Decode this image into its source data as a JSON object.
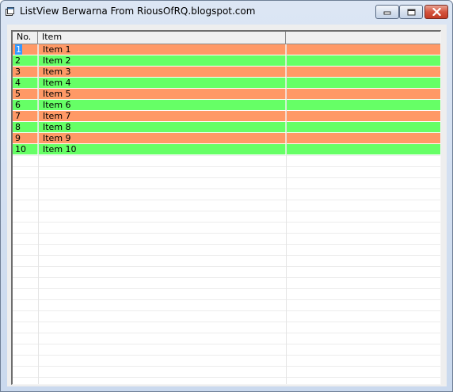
{
  "window": {
    "title": "ListView Berwarna From RiousOfRQ.blogspot.com"
  },
  "listview": {
    "columns": [
      "No.",
      "Item",
      ""
    ],
    "rows": [
      {
        "no": "1",
        "item": "Item 1"
      },
      {
        "no": "2",
        "item": "Item 2"
      },
      {
        "no": "3",
        "item": "Item 3"
      },
      {
        "no": "4",
        "item": "Item 4"
      },
      {
        "no": "5",
        "item": "Item 5"
      },
      {
        "no": "6",
        "item": "Item 6"
      },
      {
        "no": "7",
        "item": "Item 7"
      },
      {
        "no": "8",
        "item": "Item 8"
      },
      {
        "no": "9",
        "item": "Item 9"
      },
      {
        "no": "10",
        "item": "Item 10"
      }
    ],
    "row_colors": {
      "odd": "#ff9966",
      "even": "#66ff66"
    },
    "selected_color": "#3399ff"
  }
}
